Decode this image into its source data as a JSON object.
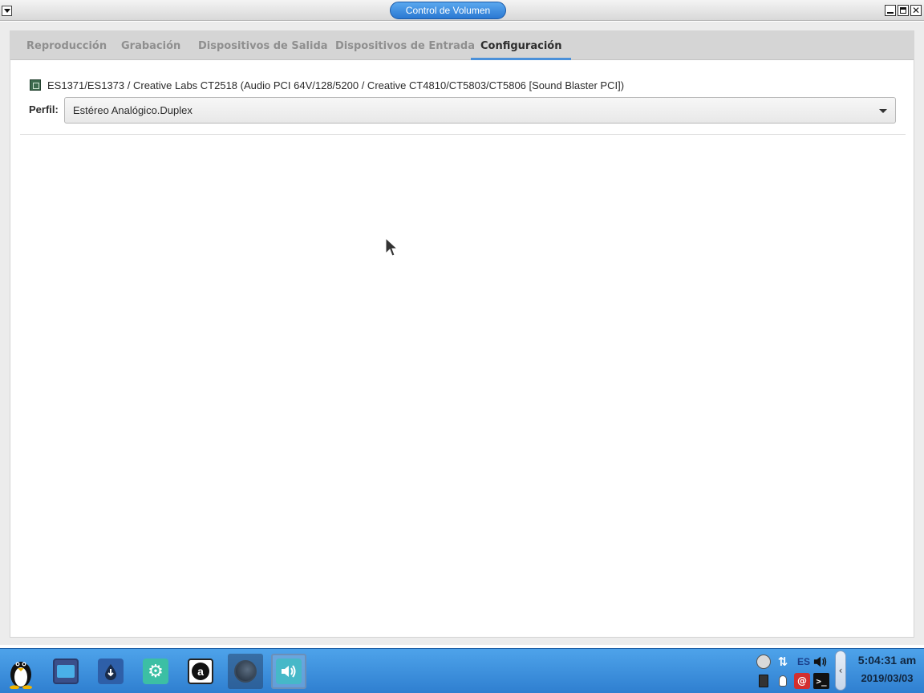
{
  "window": {
    "title": "Control de Volumen"
  },
  "tabs": [
    {
      "label": "Reproducción"
    },
    {
      "label": "Grabación"
    },
    {
      "label": "Dispositivos de Salida"
    },
    {
      "label": "Dispositivos de Entrada"
    },
    {
      "label": "Configuración",
      "active": true
    }
  ],
  "config": {
    "device_name": "ES1371/ES1373 / Creative Labs CT2518 (Audio PCI 64V/128/5200 / Creative CT4810/CT5803/CT5806 [Sound Blaster PCI])",
    "profile_label": "Perfil:",
    "profile_value": "Estéreo Analógico.Duplex"
  },
  "taskbar": {
    "apps": [
      {
        "icon": "linux-penguin-icon"
      },
      {
        "icon": "folder-icon"
      },
      {
        "icon": "download-icon"
      },
      {
        "icon": "settings-gears-icon"
      },
      {
        "icon": "appstore-a-icon"
      },
      {
        "icon": "dark-app-icon"
      },
      {
        "icon": "speaker-icon"
      }
    ],
    "tray": {
      "keyboard_layout": "ES"
    },
    "clock": {
      "time": "5:04:31 am",
      "date": "2019/03/03"
    }
  },
  "colors": {
    "accent": "#4a90d9",
    "title_pill": "#2a78d2",
    "taskbar": "#3c8ddb"
  }
}
